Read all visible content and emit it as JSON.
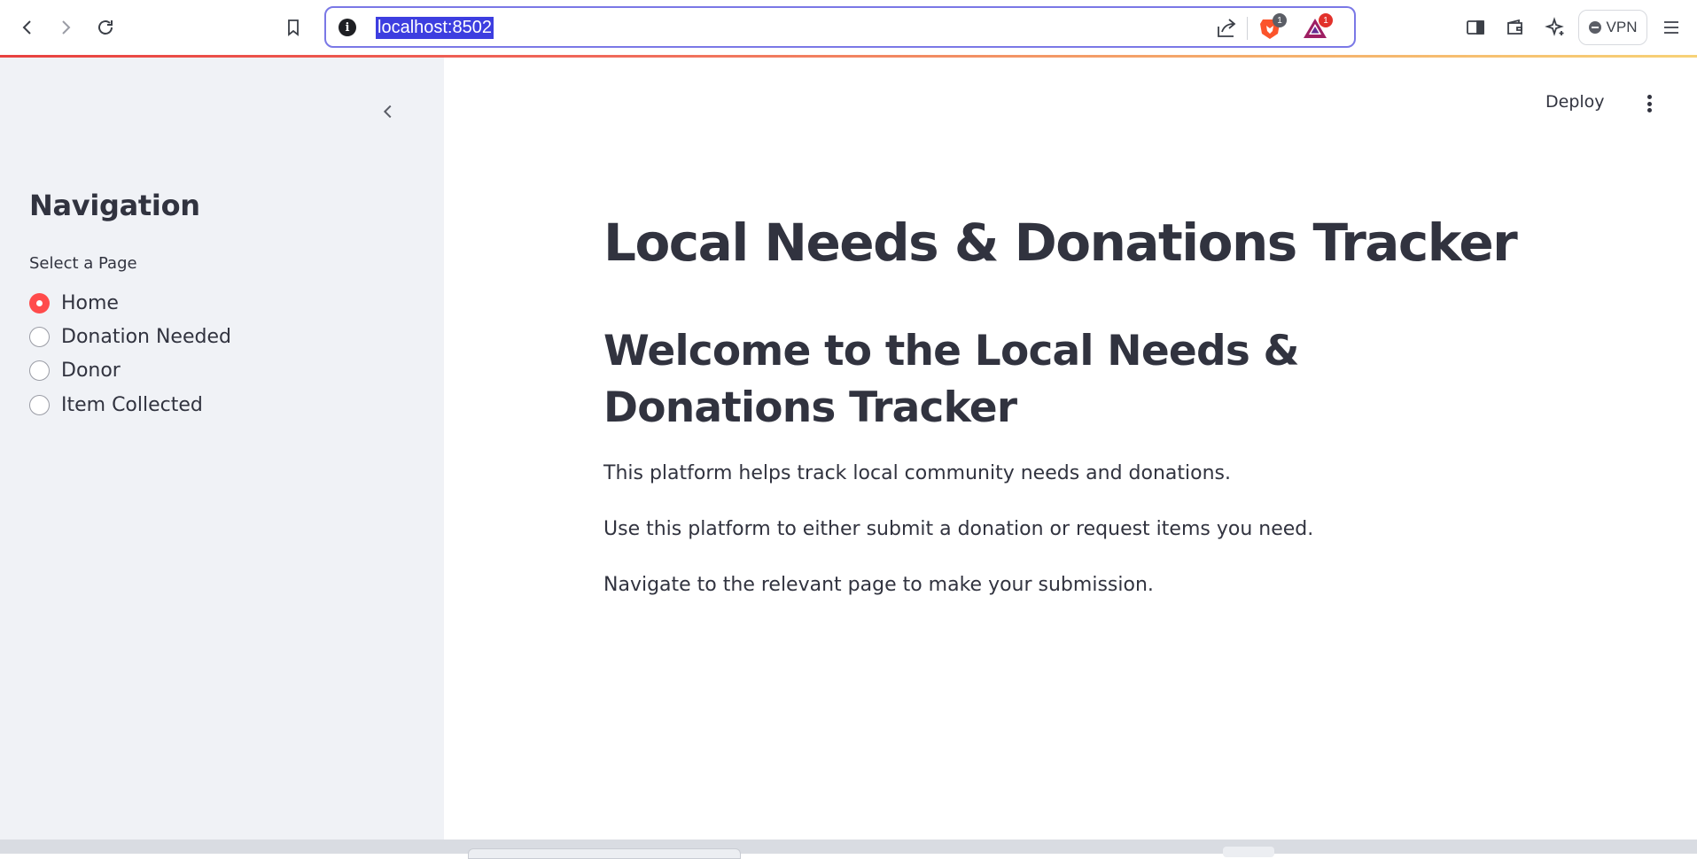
{
  "browser": {
    "url": "localhost:8502",
    "vpn_label": "VPN",
    "shield_badge": "1",
    "rewards_badge": "1",
    "colors": {
      "selection": "#3d3ee0",
      "url_border": "#7a78e6",
      "shield": "#fb542b",
      "rewards": "#e2312b"
    }
  },
  "sidebar": {
    "title": "Navigation",
    "radio_label": "Select a Page",
    "options": [
      {
        "label": "Home",
        "selected": true
      },
      {
        "label": "Donation Needed",
        "selected": false
      },
      {
        "label": "Donor",
        "selected": false
      },
      {
        "label": "Item Collected",
        "selected": false
      }
    ]
  },
  "header": {
    "deploy_label": "Deploy"
  },
  "main": {
    "title": "Local Needs & Donations Tracker",
    "subtitle": "Welcome to the Local Needs & Donations Tracker",
    "paragraphs": [
      "This platform helps track local community needs and donations.",
      "Use this platform to either submit a donation or request items you need.",
      "Navigate to the relevant page to make your submission."
    ]
  },
  "theme": {
    "accent": "#ff4b4b",
    "text": "#31333f",
    "sidebar_bg": "#f0f2f6"
  }
}
